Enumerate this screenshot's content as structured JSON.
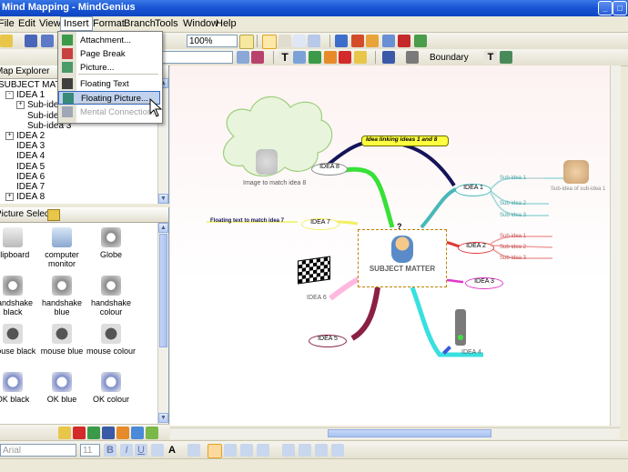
{
  "window": {
    "title": "Mind Mapping - MindGenius"
  },
  "menu": [
    "File",
    "Edit",
    "View",
    "Insert",
    "Format",
    "Branch",
    "Tools",
    "Window",
    "Help"
  ],
  "toolbar": {
    "zoom": "100%",
    "boundary_label": "Boundary"
  },
  "insert_menu": [
    {
      "label": "Attachment...",
      "icon": "paperclip-icon",
      "enabled": true
    },
    {
      "label": "Page Break",
      "icon": "page-break-icon",
      "enabled": true
    },
    {
      "label": "Picture...",
      "icon": "picture-icon",
      "enabled": true
    },
    {
      "label": "Floating Text",
      "icon": "text-icon",
      "enabled": true
    },
    {
      "label": "Floating Picture...",
      "icon": "floating-picture-icon",
      "enabled": true,
      "selected": true
    },
    {
      "label": "Mental Connection...",
      "icon": "connection-icon",
      "enabled": false
    }
  ],
  "map_explorer": {
    "title": "Map Explorer",
    "tree": [
      {
        "label": "SUBJECT MATTER",
        "level": 0
      },
      {
        "label": "IDEA 1",
        "level": 1,
        "toggle": "-"
      },
      {
        "label": "Sub-idea 1",
        "level": 2,
        "toggle": "+"
      },
      {
        "label": "Sub-idea 2",
        "level": 2
      },
      {
        "label": "Sub-idea 3",
        "level": 2
      },
      {
        "label": "IDEA 2",
        "level": 1,
        "toggle": "+"
      },
      {
        "label": "IDEA 3",
        "level": 1
      },
      {
        "label": "IDEA 4",
        "level": 1
      },
      {
        "label": "IDEA 5",
        "level": 1
      },
      {
        "label": "IDEA 6",
        "level": 1
      },
      {
        "label": "IDEA 7",
        "level": 1
      },
      {
        "label": "IDEA 8",
        "level": 1,
        "toggle": "+"
      }
    ]
  },
  "picture_selector": {
    "title": "Picture Selector",
    "items": [
      {
        "label": "clipboard",
        "icon": "clipboard-icon"
      },
      {
        "label": "computer monitor",
        "icon": "monitor-icon"
      },
      {
        "label": "Globe",
        "icon": "handshake-icon"
      },
      {
        "label": "handshake black",
        "icon": "handshake-icon"
      },
      {
        "label": "handshake blue",
        "icon": "handshake-icon"
      },
      {
        "label": "handshake colour",
        "icon": "handshake-icon"
      },
      {
        "label": "mouse black",
        "icon": "mouse-icon"
      },
      {
        "label": "mouse blue",
        "icon": "mouse-icon"
      },
      {
        "label": "mouse colour",
        "icon": "mouse-icon"
      },
      {
        "label": "OK black",
        "icon": "ok-hand-icon"
      },
      {
        "label": "OK blue",
        "icon": "ok-hand-icon"
      },
      {
        "label": "OK colour",
        "icon": "ok-hand-icon"
      }
    ]
  },
  "map": {
    "subject": "SUBJECT MATTER",
    "question_mark": "?",
    "floating_link": "Idea linking ideas 1 and 8",
    "floating_text": "Floating text to match idea 7",
    "cloud_caption": "Image to match idea 8",
    "thumb_caption": "Sub-idea of sub-idea 1",
    "ideas": [
      "IDEA 1",
      "IDEA 2",
      "IDEA 3",
      "IDEA 4",
      "IDEA 5",
      "IDEA 6",
      "IDEA 7",
      "IDEA 8"
    ],
    "idea1_subs": [
      "Sub-idea 1",
      "Sub-idea 2",
      "Sub-idea 3"
    ],
    "idea2_subs": [
      "Sub-idea 1",
      "Sub-idea 2",
      "Sub-idea 3"
    ]
  },
  "format_bar": {
    "font": "Arial",
    "size": "11"
  }
}
